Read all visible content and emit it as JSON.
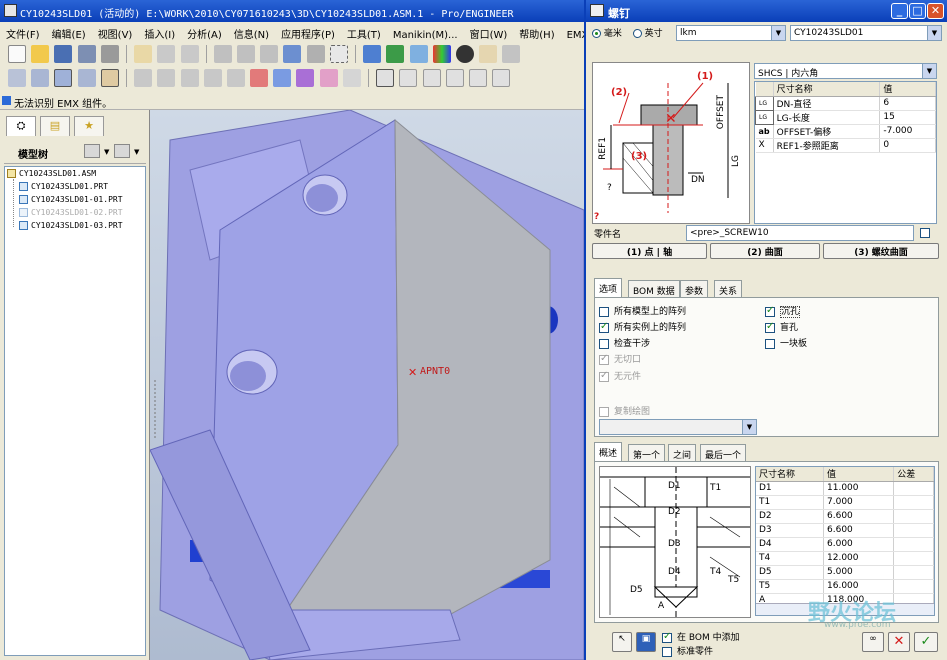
{
  "main_window": {
    "title": "CY10243SLD01 (活动的) E:\\WORK\\2010\\CY071610243\\3D\\CY10243SLD01.ASM.1 - Pro/ENGINEER",
    "menus": [
      "文件(F)",
      "编辑(E)",
      "视图(V)",
      "插入(I)",
      "分析(A)",
      "信息(N)",
      "应用程序(P)",
      "工具(T)",
      "Manikin(M)...",
      "窗口(W)",
      "帮助(H)",
      "EMX 6.0"
    ],
    "status_text": "无法识别 EMX 组件。"
  },
  "model_tree": {
    "header": "模型树",
    "items": [
      {
        "label": "CY10243SLD01.ASM",
        "dim": false
      },
      {
        "label": "CY10243SLD01.PRT",
        "dim": false
      },
      {
        "label": "CY10243SLD01-01.PRT",
        "dim": false
      },
      {
        "label": "CY10243SLD01-02.PRT",
        "dim": true
      },
      {
        "label": "CY10243SLD01-03.PRT",
        "dim": false
      }
    ]
  },
  "viewport": {
    "datum_label": "APNT0"
  },
  "dialog": {
    "title": "螺钉",
    "units": {
      "mm": "毫米",
      "inch": "英寸",
      "selected": "mm"
    },
    "family_combo": "lkm",
    "assembly_combo": "CY10243SLD01",
    "type_combo": "SHCS | 内六角",
    "diagram_labels": {
      "c1": "(1)",
      "c2": "(2)",
      "c3": "(3)",
      "offset": "OFFSET",
      "ref1": "REF1",
      "lg": "LG",
      "dn": "DN",
      "q": "?"
    },
    "param_table": {
      "headers": [
        "尺寸名称",
        "值"
      ],
      "rows": [
        {
          "icon": "LG",
          "name": "DN-直径",
          "value": "6"
        },
        {
          "icon": "LG",
          "name": "LG-长度",
          "value": "15"
        },
        {
          "icon": "ab",
          "name": "OFFSET-偏移",
          "value": "-7.000"
        },
        {
          "icon": "X",
          "name": "REF1-参照距离",
          "value": "0"
        }
      ]
    },
    "part_name_label": "零件名",
    "part_name_value": "<pre>_SCREW10",
    "ref_buttons": [
      "(1) 点 | 轴",
      "(2) 曲面",
      "(3) 螺纹曲面"
    ],
    "tabs": [
      "选项",
      "BOM 数据",
      "参数",
      "关系"
    ],
    "options_left": [
      {
        "label": "所有模型上的阵列",
        "checked": false,
        "disabled": false
      },
      {
        "label": "所有实例上的阵列",
        "checked": true,
        "disabled": false
      },
      {
        "label": "检查干涉",
        "checked": false,
        "disabled": false
      },
      {
        "label": "无切口",
        "checked": true,
        "disabled": true
      },
      {
        "label": "无元件",
        "checked": true,
        "disabled": true
      }
    ],
    "options_right": [
      {
        "label": "沉孔",
        "checked": true
      },
      {
        "label": "盲孔",
        "checked": true
      },
      {
        "label": "一块板",
        "checked": false
      }
    ],
    "copy_drawing_label": "复制绘图",
    "bottom_tabs": [
      "概述",
      "第一个",
      "之间",
      "最后一个"
    ],
    "bottom_diagram_labels": {
      "d1": "D1",
      "t1": "T1",
      "d2": "D2",
      "d3": "D3",
      "d4": "D4",
      "t4": "T4",
      "t5": "T5",
      "d5": "D5",
      "a": "A"
    },
    "dim_table": {
      "headers": [
        "尺寸名称",
        "值",
        "公差"
      ],
      "rows": [
        {
          "name": "D1",
          "value": "11.000"
        },
        {
          "name": "T1",
          "value": "7.000"
        },
        {
          "name": "D2",
          "value": "6.600"
        },
        {
          "name": "D3",
          "value": "6.600"
        },
        {
          "name": "D4",
          "value": "6.000"
        },
        {
          "name": "T4",
          "value": "12.000"
        },
        {
          "name": "D5",
          "value": "5.000"
        },
        {
          "name": "T5",
          "value": "16.000"
        },
        {
          "name": "A",
          "value": "118.000"
        }
      ]
    },
    "bom_add_label": "在 BOM 中添加",
    "standard_part_label": "标准零件",
    "watermark": "野火论坛",
    "watermark_url": "www.proe.com"
  },
  "colors": {
    "title_blue": "#0a3fb8",
    "model_face": "#9ea2e6",
    "model_top": "#b3b6bd",
    "pipe_blue": "#2040d0",
    "accent_red": "#d41a1a"
  }
}
